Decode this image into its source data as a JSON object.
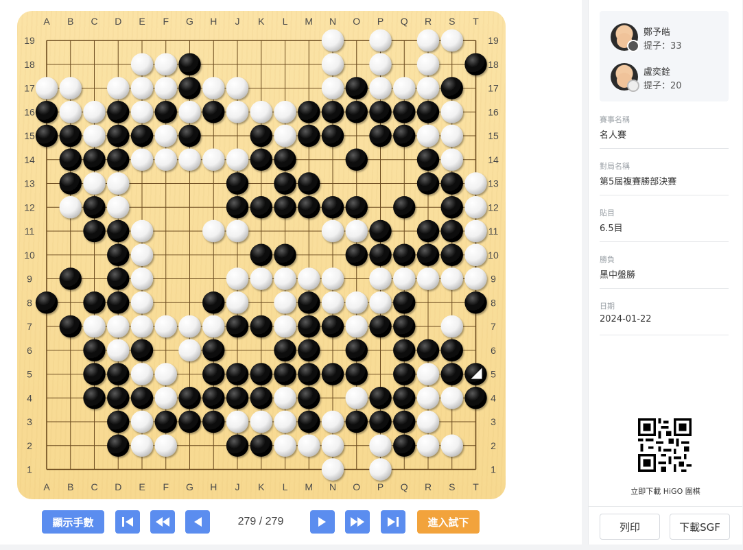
{
  "board": {
    "size": 19,
    "columns": [
      "A",
      "B",
      "C",
      "D",
      "E",
      "F",
      "G",
      "H",
      "J",
      "K",
      "L",
      "M",
      "N",
      "O",
      "P",
      "Q",
      "R",
      "S",
      "T"
    ],
    "rows": [
      "19",
      "18",
      "17",
      "16",
      "15",
      "14",
      "13",
      "12",
      "11",
      "10",
      "9",
      "8",
      "7",
      "6",
      "5",
      "4",
      "3",
      "2",
      "1"
    ],
    "position": [
      "............W.W.WW.",
      "....WWB.....W.W.W.B",
      "WW.WWWBWW...WBWWWB.",
      "BWWBWBWBWWWBBBBBBW.",
      "BBWBBWB..BWBB.BBWW.",
      ".BBBWWWWWBB..B..BW.",
      ".BWW....B.BB....BBW",
      ".WBW....BBBBBB.B.BW",
      "..BBW..WW...WWB.BBWW",
      "...BW....BB..BBBBBW",
      ".B.BW...WWWWW.WWWWW",
      "B.BBW..BW.WBWWWB..B",
      ".BWWWWWWBBWBBWBB.W.",
      "..BWB.WB..BB.B.BBB.",
      "..BBWW.BBBBBBB.BWBB",
      "..BBBWBBBBWB.WBBWWB",
      "...BWBBBWWWBWBBBW..W",
      "...BWW..BBWWW.WBWW..",
      "............W.W...."
    ],
    "last_move_marker": "T5",
    "star_points": [
      "D16"
    ]
  },
  "controls": {
    "show_moves_label": "顯示手數",
    "move_counter": "279 / 279",
    "try_label": "進入試下",
    "first_icon": "skip-to-start-icon",
    "back5_icon": "fast-backward-icon",
    "back_icon": "step-back-icon",
    "forward_icon": "step-forward-icon",
    "forward5_icon": "fast-forward-icon",
    "last_icon": "skip-to-end-icon"
  },
  "players": {
    "black": {
      "name": "鄭予皓",
      "captures": "提子：33"
    },
    "white": {
      "name": "盧奕銓",
      "captures": "提子：20"
    }
  },
  "info": {
    "event_label": "賽事名稱",
    "event_value": "名人賽",
    "round_label": "對局名稱",
    "round_value": "第5屆複賽勝部決賽",
    "komi_label": "貼目",
    "komi_value": "6.5目",
    "result_label": "勝負",
    "result_value": "黑中盤勝",
    "date_label": "日期",
    "date_value": "2024-01-22"
  },
  "sidebar": {
    "qr_caption": "立即下載 HiGO 圍棋",
    "print_label": "列印",
    "download_label": "下載SGF"
  },
  "colors": {
    "accent_blue": "#5b8def",
    "accent_orange": "#f2a33c",
    "board_wood": "#f7d990"
  }
}
